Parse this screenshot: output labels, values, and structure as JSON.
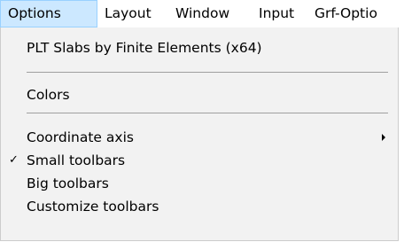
{
  "menubar": {
    "items": [
      {
        "label": "Options",
        "active": true
      },
      {
        "label": "Layout"
      },
      {
        "label": "Window"
      },
      {
        "label": "Input"
      },
      {
        "label": "Grf-Optio"
      }
    ]
  },
  "dropdown": {
    "items": [
      {
        "label": "PLT Slabs by Finite Elements (x64)"
      },
      {
        "label": "Colors"
      },
      {
        "label": "Coordinate axis",
        "submenu": true
      },
      {
        "label": "Small toolbars",
        "checked": true,
        "check_glyph": "✓"
      },
      {
        "label": "Big toolbars"
      },
      {
        "label": "Customize toolbars"
      }
    ]
  },
  "colors": {
    "menu_background": "#f2f2f2",
    "active_menu_highlight": "#cce8ff",
    "active_menu_border": "#99d1ff",
    "separator": "#a0a0a0"
  },
  "icons": {
    "check": "check-icon",
    "submenu": "submenu-arrow-icon"
  }
}
